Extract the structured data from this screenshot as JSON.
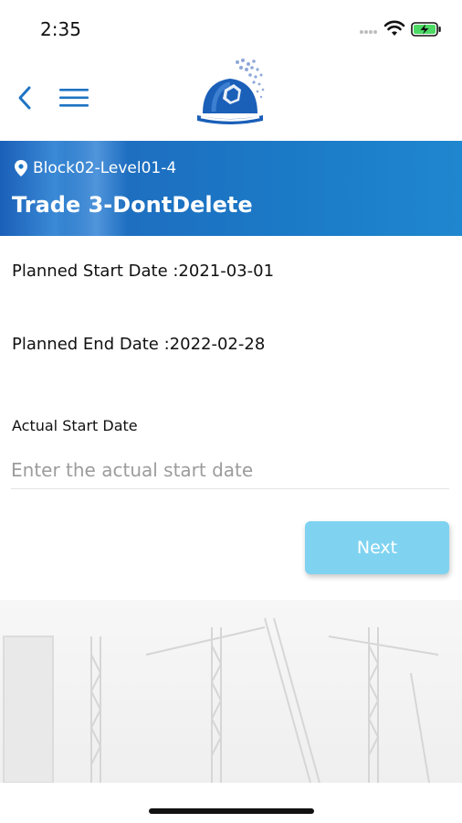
{
  "status_bar": {
    "time": "2:35"
  },
  "icons": {
    "back": "chevron-left-icon",
    "menu": "hamburger-menu-icon",
    "logo": "hard-hat-logo",
    "location": "map-pin-icon",
    "wifi": "wifi-icon",
    "battery": "battery-charging-icon"
  },
  "colors": {
    "accent": "#1f74c4",
    "banner": "#1b79c6",
    "button": "#7fd3f1",
    "battery": "#4cd964"
  },
  "banner": {
    "location": "Block02-Level01-4",
    "title": "Trade 3-DontDelete"
  },
  "details": {
    "planned_start": "Planned Start Date :2021-03-01",
    "planned_end": "Planned End Date :2022-02-28"
  },
  "actual_start": {
    "label": "Actual Start Date",
    "value": "",
    "placeholder": "Enter the actual start date"
  },
  "actions": {
    "next_label": "Next"
  }
}
